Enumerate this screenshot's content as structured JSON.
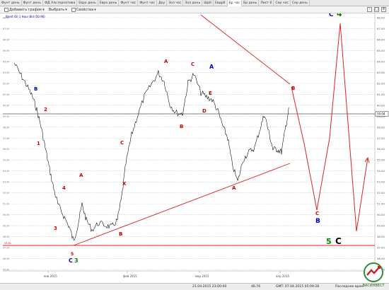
{
  "tabs": [
    "Фунт день",
    "Фунт день",
    "ФД Альтернатива",
    "Евро день",
    "Евро день",
    "Фунт час",
    "Фунт час",
    "Доу",
    "Зол час",
    "Зол день",
    "Шрб",
    "Евдрб",
    "Бр час",
    "Бр день",
    "Лист 6",
    "Сер час",
    "Сер день"
  ],
  "active_tab_index": 12,
  "toolbar": {
    "add_chart": "Добавить график",
    "select": "Выбрать",
    "properties": "Свойства"
  },
  "chart": {
    "info": "Brent Oil 1 Hour Bid (50.96)",
    "price_tag": "59.04",
    "level_low_label": "54.81",
    "date_labels": [
      "янв 2015",
      "фев 2015",
      "мар 2015",
      "апр 2015"
    ],
    "price_labels": [
      "68.00",
      "67.00",
      "66.00",
      "65.00",
      "64.00",
      "63.00",
      "62.00",
      "61.00",
      "60.00",
      "59.00",
      "58.00",
      "57.00",
      "56.00",
      "55.00",
      "54.00",
      "53.00",
      "52.00",
      "51.00",
      "50.00",
      "49.00",
      "48.00",
      "47.00",
      "46.00",
      "45.00"
    ],
    "wave_labels": [
      {
        "t": "B",
        "c": "#0000cc"
      },
      {
        "t": "2",
        "c": "#cc0000"
      },
      {
        "t": "1",
        "c": "#cc0000"
      },
      {
        "t": "4",
        "c": "#cc0000"
      },
      {
        "t": "3",
        "c": "#cc0000"
      },
      {
        "t": "5",
        "c": "#cc0000"
      },
      {
        "t": "C",
        "c": "#0000cc"
      },
      {
        "t": "3",
        "c": "#008800"
      },
      {
        "t": "A",
        "c": "#cc0000"
      },
      {
        "t": "B",
        "c": "#cc0000"
      },
      {
        "t": "C",
        "c": "#cc0000"
      },
      {
        "t": "X",
        "c": "#cc0000"
      },
      {
        "t": "A",
        "c": "#cc0000"
      },
      {
        "t": "B",
        "c": "#cc0000"
      },
      {
        "t": "C",
        "c": "#cc0000"
      },
      {
        "t": "D",
        "c": "#cc0000"
      },
      {
        "t": "E",
        "c": "#cc0000"
      },
      {
        "t": "A",
        "c": "#0000cc"
      },
      {
        "t": "A",
        "c": "#cc0000"
      },
      {
        "t": "B",
        "c": "#cc0000"
      },
      {
        "t": "C",
        "c": "#cc0000"
      },
      {
        "t": "B",
        "c": "#0000cc"
      },
      {
        "t": "C",
        "c": "#0000cc"
      },
      {
        "t": "4",
        "c": "#008800"
      },
      {
        "t": "5",
        "c": "#008800"
      },
      {
        "t": "C",
        "c": "#000000"
      }
    ]
  },
  "status": {
    "time": "21.04.2015 23:00:00",
    "value": "46.76",
    "gmt": "GMT: 07.04.2015 05:09:28",
    "last": "Последнее врем"
  },
  "logo_text": "ВАСИНВЕСТ",
  "colors": {
    "wave_red": "#dd2222",
    "grid": "#c8c8c8",
    "price_line": "#000000",
    "candle": "#000000"
  }
}
